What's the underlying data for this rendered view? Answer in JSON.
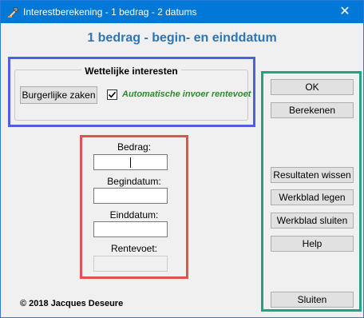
{
  "window": {
    "title": "Interestberekening - 1 bedrag - 2 datums",
    "close_glyph": "✕"
  },
  "heading": "1 bedrag - begin- en einddatum",
  "group": {
    "title": "Wettelijke interesten",
    "burger_button": "Burgerlijke zaken",
    "checkbox_label": "Automatische invoer rentevoet",
    "checkbox_checked": true
  },
  "fields": {
    "bedrag_label": "Bedrag:",
    "bedrag_value": "",
    "begindatum_label": "Begindatum:",
    "begindatum_value": "",
    "einddatum_label": "Einddatum:",
    "einddatum_value": "",
    "rentevoet_label": "Rentevoet:",
    "rentevoet_value": ""
  },
  "buttons": {
    "ok": "OK",
    "berekenen": "Berekenen",
    "resultaten_wissen": "Resultaten wissen",
    "werkblad_legen": "Werkblad legen",
    "werkblad_sluiten": "Werkblad sluiten",
    "help": "Help",
    "sluiten": "Sluiten"
  },
  "footer": {
    "copyright": "© 2018 Jacques Deseure"
  },
  "colors": {
    "titlebar": "#0078d7",
    "heading": "#2e75b6",
    "annotation_blue": "#4f5fe0",
    "annotation_red": "#e05353",
    "annotation_green": "#22a37f",
    "checkbox_label": "#2e8b2e"
  },
  "icons": [
    "app-icon",
    "close-icon",
    "checkmark-icon"
  ]
}
